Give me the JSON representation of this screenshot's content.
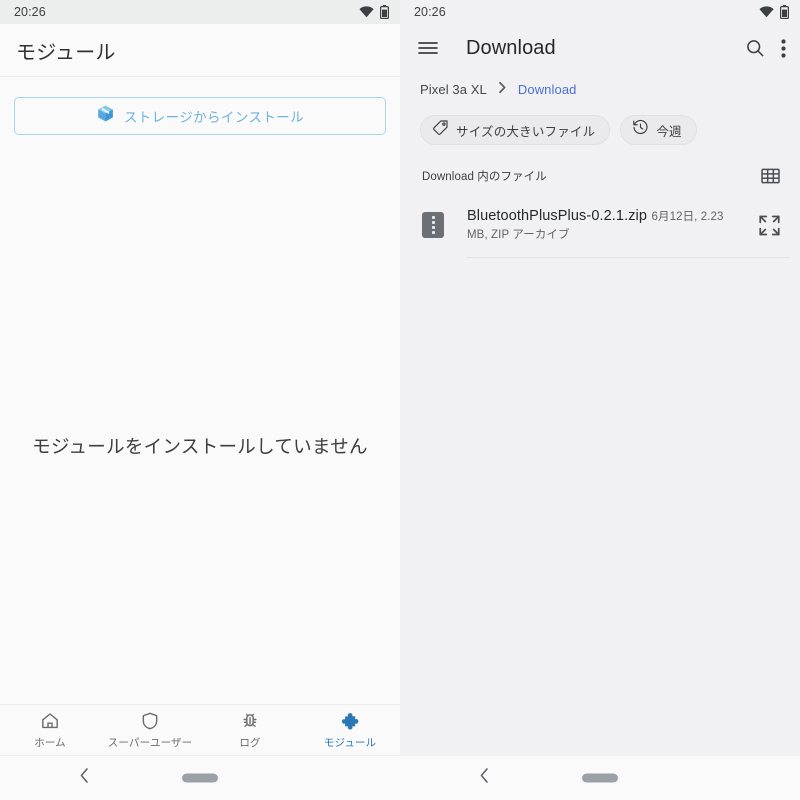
{
  "left_phone": {
    "status_bar": {
      "time": "20:26",
      "wifi_icon": "wifi-icon",
      "battery_icon": "battery-icon"
    },
    "app_bar": {
      "title": "モジュール"
    },
    "install_button": {
      "icon": "package-box-icon",
      "label": "ストレージからインストール",
      "accent_color": "#6cb3e0",
      "border_color": "#a8d4ec"
    },
    "empty_state": {
      "message": "モジュールをインストールしていません"
    },
    "bottom_nav": {
      "active_color": "#2b77b5",
      "inactive_color": "#6b6b6b",
      "items": [
        {
          "label": "ホーム",
          "icon": "home-icon",
          "active": false
        },
        {
          "label": "スーパーユーザー",
          "icon": "shield-icon",
          "active": false
        },
        {
          "label": "ログ",
          "icon": "bug-icon",
          "active": false
        },
        {
          "label": "モジュール",
          "icon": "puzzle-piece-icon",
          "active": true
        }
      ]
    },
    "system_nav": {
      "back_icon": "chevron-left-icon",
      "home_pill": "home-pill-handle"
    }
  },
  "right_phone": {
    "status_bar": {
      "time": "20:26",
      "wifi_icon": "wifi-icon",
      "battery_icon": "battery-icon"
    },
    "app_bar": {
      "menu_icon": "hamburger-menu-icon",
      "title": "Download",
      "search_icon": "search-icon",
      "overflow_icon": "overflow-menu-icon"
    },
    "breadcrumb": {
      "root": "Pixel 3a XL",
      "separator": "›",
      "current": "Download",
      "current_color": "#4a6fd4"
    },
    "chips": [
      {
        "label": "サイズの大きいファイル",
        "icon": "tag-icon"
      },
      {
        "label": "今週",
        "icon": "history-clock-icon"
      }
    ],
    "section": {
      "title": "Download 内のファイル",
      "grid_view_icon": "grid-view-icon"
    },
    "files": [
      {
        "icon": "zip-archive-icon",
        "name": "BluetoothPlusPlus-0.2.1.zip",
        "details": "6月12日, 2.23 MB, ZIP アーカイブ",
        "expand_icon": "expand-fullscreen-icon"
      }
    ],
    "system_nav": {
      "back_icon": "chevron-left-icon",
      "home_pill": "home-pill-handle"
    }
  }
}
